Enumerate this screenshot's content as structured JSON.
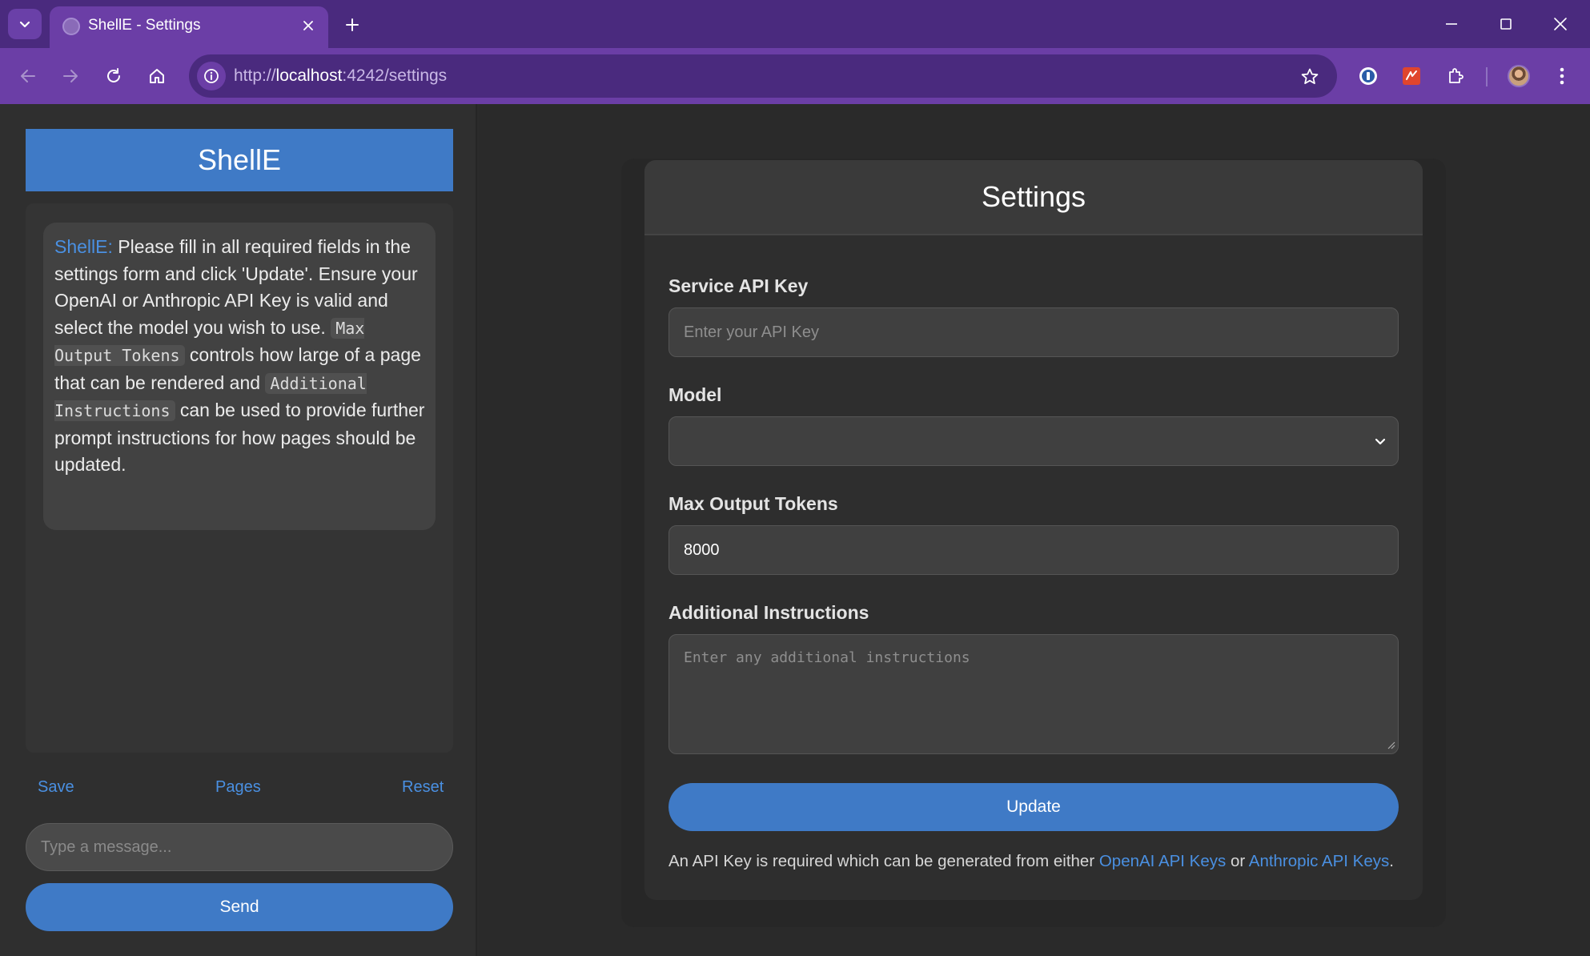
{
  "browser": {
    "tab_title": "ShellE - Settings",
    "url_scheme": "http://",
    "url_host": "localhost",
    "url_path": ":4242/settings"
  },
  "sidebar": {
    "brand": "ShellE",
    "message": {
      "sender": "ShellE:",
      "text_1": " Please fill in all required fields in the settings form and click 'Update'. Ensure your OpenAI or Anthropic API Key is valid and select the model you wish to use.",
      "code_1": "Max Output Tokens",
      "text_2": " controls how large of a page that can be rendered and ",
      "code_2": "Additional Instructions",
      "text_3": " can be used to provide further prompt instructions for how pages should be updated."
    },
    "links": {
      "save": "Save",
      "pages": "Pages",
      "reset": "Reset"
    },
    "input_placeholder": "Type a message...",
    "send_label": "Send"
  },
  "settings": {
    "title": "Settings",
    "api_key_label": "Service API Key",
    "api_key_placeholder": "Enter your API Key",
    "model_label": "Model",
    "model_value": "",
    "max_tokens_label": "Max Output Tokens",
    "max_tokens_value": "8000",
    "instructions_label": "Additional Instructions",
    "instructions_placeholder": "Enter any additional instructions",
    "update_label": "Update",
    "footnote_prefix": "An API Key is required which can be generated from either ",
    "openai_link": "OpenAI API Keys",
    "footnote_or": " or ",
    "anthropic_link": "Anthropic API Keys",
    "footnote_suffix": "."
  },
  "colors": {
    "accent": "#3f7ac6",
    "link": "#4a90e2",
    "chrome_dark": "#4a2a7e",
    "chrome": "#6b3ea6"
  }
}
